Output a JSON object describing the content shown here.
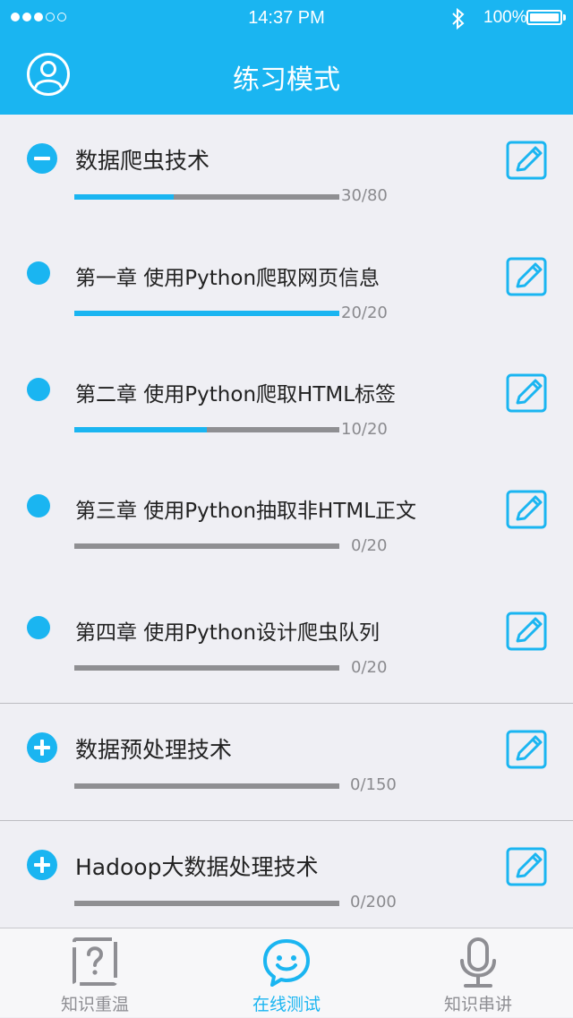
{
  "status_bar": {
    "time": "14:37 PM",
    "battery": "100%"
  },
  "header": {
    "title": "练习模式"
  },
  "sections": [
    {
      "title": "数据爬虫技术",
      "expanded": true,
      "progress": "30/80",
      "progress_fraction": 0.375,
      "chapters": [
        {
          "title": "第一章 使用Python爬取网页信息",
          "progress": "20/20",
          "progress_fraction": 1.0
        },
        {
          "title": "第二章 使用Python爬取HTML标签",
          "progress": "10/20",
          "progress_fraction": 0.5
        },
        {
          "title": "第三章 使用Python抽取非HTML正文",
          "progress": "0/20",
          "progress_fraction": 0
        },
        {
          "title": "第四章 使用Python设计爬虫队列",
          "progress": "0/20",
          "progress_fraction": 0
        }
      ]
    },
    {
      "title": "数据预处理技术",
      "expanded": false,
      "progress": "0/150",
      "progress_fraction": 0
    },
    {
      "title": "Hadoop大数据处理技术",
      "expanded": false,
      "progress": "0/200",
      "progress_fraction": 0
    }
  ],
  "tabbar": {
    "tabs": [
      {
        "label": "知识重温",
        "icon": "question-card-icon",
        "active": false
      },
      {
        "label": "在线测试",
        "icon": "smiley-chat-icon",
        "active": true
      },
      {
        "label": "知识串讲",
        "icon": "microphone-icon",
        "active": false
      }
    ]
  },
  "colors": {
    "accent": "#1ab5f1",
    "track": "#8f8f92",
    "background": "#efeff4"
  }
}
